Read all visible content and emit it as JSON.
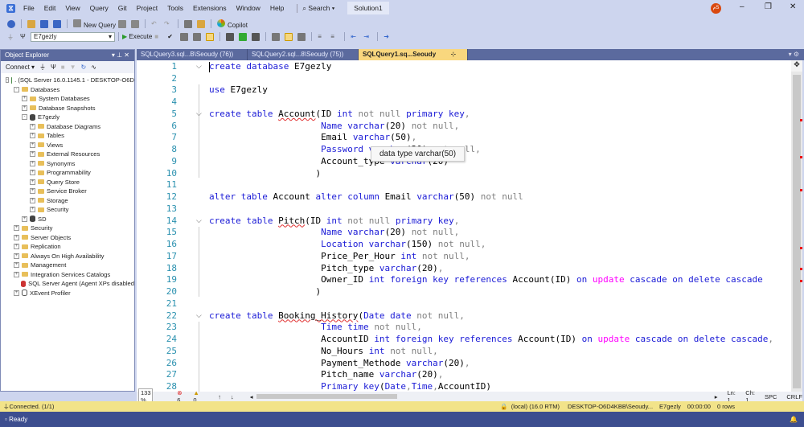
{
  "menu": {
    "items": [
      "File",
      "Edit",
      "View",
      "Query",
      "Git",
      "Project",
      "Tools",
      "Extensions",
      "Window",
      "Help"
    ],
    "search": "Search",
    "solution": "Solution1",
    "avatar": "مS"
  },
  "toolbar": {
    "new_query": "New Query",
    "copilot": "Copilot",
    "database": "E7gezly",
    "execute": "Execute"
  },
  "object_explorer": {
    "title": "Object Explorer",
    "connect": "Connect",
    "tree": [
      {
        "level": 0,
        "exp": "-",
        "icon": "server",
        "label": ". (SQL Server 16.0.1145.1 - DESKTOP-O6D"
      },
      {
        "level": 1,
        "exp": "-",
        "icon": "folder",
        "label": "Databases"
      },
      {
        "level": 2,
        "exp": "+",
        "icon": "folder",
        "label": "System Databases"
      },
      {
        "level": 2,
        "exp": "+",
        "icon": "folder",
        "label": "Database Snapshots"
      },
      {
        "level": 2,
        "exp": "-",
        "icon": "db",
        "label": "E7gezly"
      },
      {
        "level": 3,
        "exp": "+",
        "icon": "folder",
        "label": "Database Diagrams"
      },
      {
        "level": 3,
        "exp": "+",
        "icon": "folder",
        "label": "Tables"
      },
      {
        "level": 3,
        "exp": "+",
        "icon": "folder",
        "label": "Views"
      },
      {
        "level": 3,
        "exp": "+",
        "icon": "folder",
        "label": "External Resources"
      },
      {
        "level": 3,
        "exp": "+",
        "icon": "folder",
        "label": "Synonyms"
      },
      {
        "level": 3,
        "exp": "+",
        "icon": "folder",
        "label": "Programmability"
      },
      {
        "level": 3,
        "exp": "+",
        "icon": "folder",
        "label": "Query Store"
      },
      {
        "level": 3,
        "exp": "+",
        "icon": "folder",
        "label": "Service Broker"
      },
      {
        "level": 3,
        "exp": "+",
        "icon": "folder",
        "label": "Storage"
      },
      {
        "level": 3,
        "exp": "+",
        "icon": "folder",
        "label": "Security"
      },
      {
        "level": 2,
        "exp": "+",
        "icon": "db",
        "label": "SD"
      },
      {
        "level": 1,
        "exp": "+",
        "icon": "folder",
        "label": "Security"
      },
      {
        "level": 1,
        "exp": "+",
        "icon": "folder",
        "label": "Server Objects"
      },
      {
        "level": 1,
        "exp": "+",
        "icon": "folder",
        "label": "Replication"
      },
      {
        "level": 1,
        "exp": "+",
        "icon": "folder",
        "label": "Always On High Availability"
      },
      {
        "level": 1,
        "exp": "+",
        "icon": "folder",
        "label": "Management"
      },
      {
        "level": 1,
        "exp": "+",
        "icon": "folder",
        "label": "Integration Services Catalogs"
      },
      {
        "level": 1,
        "exp": "",
        "icon": "agent",
        "label": "SQL Server Agent (Agent XPs disabled"
      },
      {
        "level": 1,
        "exp": "+",
        "icon": "xevent",
        "label": "XEvent Profiler"
      }
    ]
  },
  "tabs": [
    {
      "label": "SQLQuery3.sql...B\\Seoudy (76))"
    },
    {
      "label": "SQLQuery2.sql...8\\Seoudy (75))"
    },
    {
      "label": "SQLQuery1.sq...Seoudy (74))",
      "active": true
    }
  ],
  "editor": {
    "tooltip": "data type varchar(50)",
    "lines": [
      [
        [
          "k",
          "create database "
        ],
        [
          "t",
          "E7gezly"
        ]
      ],
      [],
      [
        [
          "k",
          "use "
        ],
        [
          "t",
          "E7gezly"
        ]
      ],
      [],
      [
        [
          "k",
          "create table "
        ],
        [
          "tu",
          "Account"
        ],
        [
          "t",
          "(ID "
        ],
        [
          "k",
          "int "
        ],
        [
          "g",
          "not null "
        ],
        [
          "k",
          "primary key"
        ],
        [
          "g",
          ","
        ]
      ],
      [
        [
          "t",
          "                     "
        ],
        [
          "k",
          "Name varchar"
        ],
        [
          "t",
          "(20) "
        ],
        [
          "g",
          "not null,"
        ]
      ],
      [
        [
          "t",
          "                     Email "
        ],
        [
          "k",
          "varchar"
        ],
        [
          "t",
          "(50)"
        ],
        [
          "g",
          ","
        ]
      ],
      [
        [
          "t",
          "                     "
        ],
        [
          "k",
          "Password varchar"
        ],
        [
          "t",
          "(20) "
        ],
        [
          "g",
          "not null,"
        ]
      ],
      [
        [
          "t",
          "                     Account_type "
        ],
        [
          "k",
          "varchar"
        ],
        [
          "t",
          "(20)"
        ]
      ],
      [
        [
          "t",
          "                    )"
        ]
      ],
      [],
      [
        [
          "k",
          "alter table "
        ],
        [
          "t",
          "Account "
        ],
        [
          "k",
          "alter column "
        ],
        [
          "t",
          "Email "
        ],
        [
          "k",
          "varchar"
        ],
        [
          "t",
          "(50) "
        ],
        [
          "g",
          "not null"
        ]
      ],
      [],
      [
        [
          "k",
          "create table "
        ],
        [
          "tu",
          "Pitch"
        ],
        [
          "t",
          "(ID "
        ],
        [
          "k",
          "int "
        ],
        [
          "g",
          "not null "
        ],
        [
          "k",
          "primary key"
        ],
        [
          "g",
          ","
        ]
      ],
      [
        [
          "t",
          "                     "
        ],
        [
          "k",
          "Name varchar"
        ],
        [
          "t",
          "(20) "
        ],
        [
          "g",
          "not null,"
        ]
      ],
      [
        [
          "t",
          "                     "
        ],
        [
          "k",
          "Location varchar"
        ],
        [
          "t",
          "(150) "
        ],
        [
          "g",
          "not null,"
        ]
      ],
      [
        [
          "t",
          "                     Price_Per_Hour "
        ],
        [
          "k",
          "int "
        ],
        [
          "g",
          "not null,"
        ]
      ],
      [
        [
          "t",
          "                     Pitch_type "
        ],
        [
          "k",
          "varchar"
        ],
        [
          "t",
          "(20)"
        ],
        [
          "g",
          ","
        ]
      ],
      [
        [
          "t",
          "                     Owner_ID "
        ],
        [
          "k",
          "int foreign key references "
        ],
        [
          "t",
          "Account(ID) "
        ],
        [
          "k",
          "on "
        ],
        [
          "m",
          "update "
        ],
        [
          "k",
          "cascade on delete cascade"
        ]
      ],
      [
        [
          "t",
          "                    )"
        ]
      ],
      [],
      [
        [
          "k",
          "create table "
        ],
        [
          "tu",
          "Booking_History"
        ],
        [
          "t",
          "("
        ],
        [
          "k",
          "Date date "
        ],
        [
          "g",
          "not null,"
        ]
      ],
      [
        [
          "t",
          "                     "
        ],
        [
          "k",
          "Time time "
        ],
        [
          "g",
          "not null,"
        ]
      ],
      [
        [
          "t",
          "                     AccountID "
        ],
        [
          "k",
          "int foreign key references "
        ],
        [
          "t",
          "Account(ID) "
        ],
        [
          "k",
          "on "
        ],
        [
          "m",
          "update "
        ],
        [
          "k",
          "cascade on delete cascade"
        ],
        [
          "g",
          ","
        ]
      ],
      [
        [
          "t",
          "                     No_Hours "
        ],
        [
          "k",
          "int "
        ],
        [
          "g",
          "not null,"
        ]
      ],
      [
        [
          "t",
          "                     Payment_Methode "
        ],
        [
          "k",
          "varchar"
        ],
        [
          "t",
          "(20)"
        ],
        [
          "g",
          ","
        ]
      ],
      [
        [
          "t",
          "                     Pitch_name "
        ],
        [
          "k",
          "varchar"
        ],
        [
          "t",
          "(20)"
        ],
        [
          "g",
          ","
        ]
      ],
      [
        [
          "t",
          "                     "
        ],
        [
          "k",
          "Primary key"
        ],
        [
          "t",
          "("
        ],
        [
          "k",
          "Date"
        ],
        [
          "g",
          ","
        ],
        [
          "k",
          "Time"
        ],
        [
          "g",
          ","
        ],
        [
          "t",
          "AccountID)"
        ]
      ]
    ]
  },
  "editor_status": {
    "zoom": "133 %",
    "errors": "6",
    "warnings": "0",
    "ln": "Ln: 1",
    "ch": "Ch: 1",
    "spc": "SPC",
    "crlf": "CRLF"
  },
  "status": {
    "connected": "Connected. (1/1)",
    "server": "(local) (16.0 RTM)",
    "user": "DESKTOP-O6D4KBB\\Seoudy...",
    "db": "E7gezly",
    "time": "00:00:00",
    "rows": "0 rows"
  },
  "bottom": {
    "ready": "Ready"
  }
}
